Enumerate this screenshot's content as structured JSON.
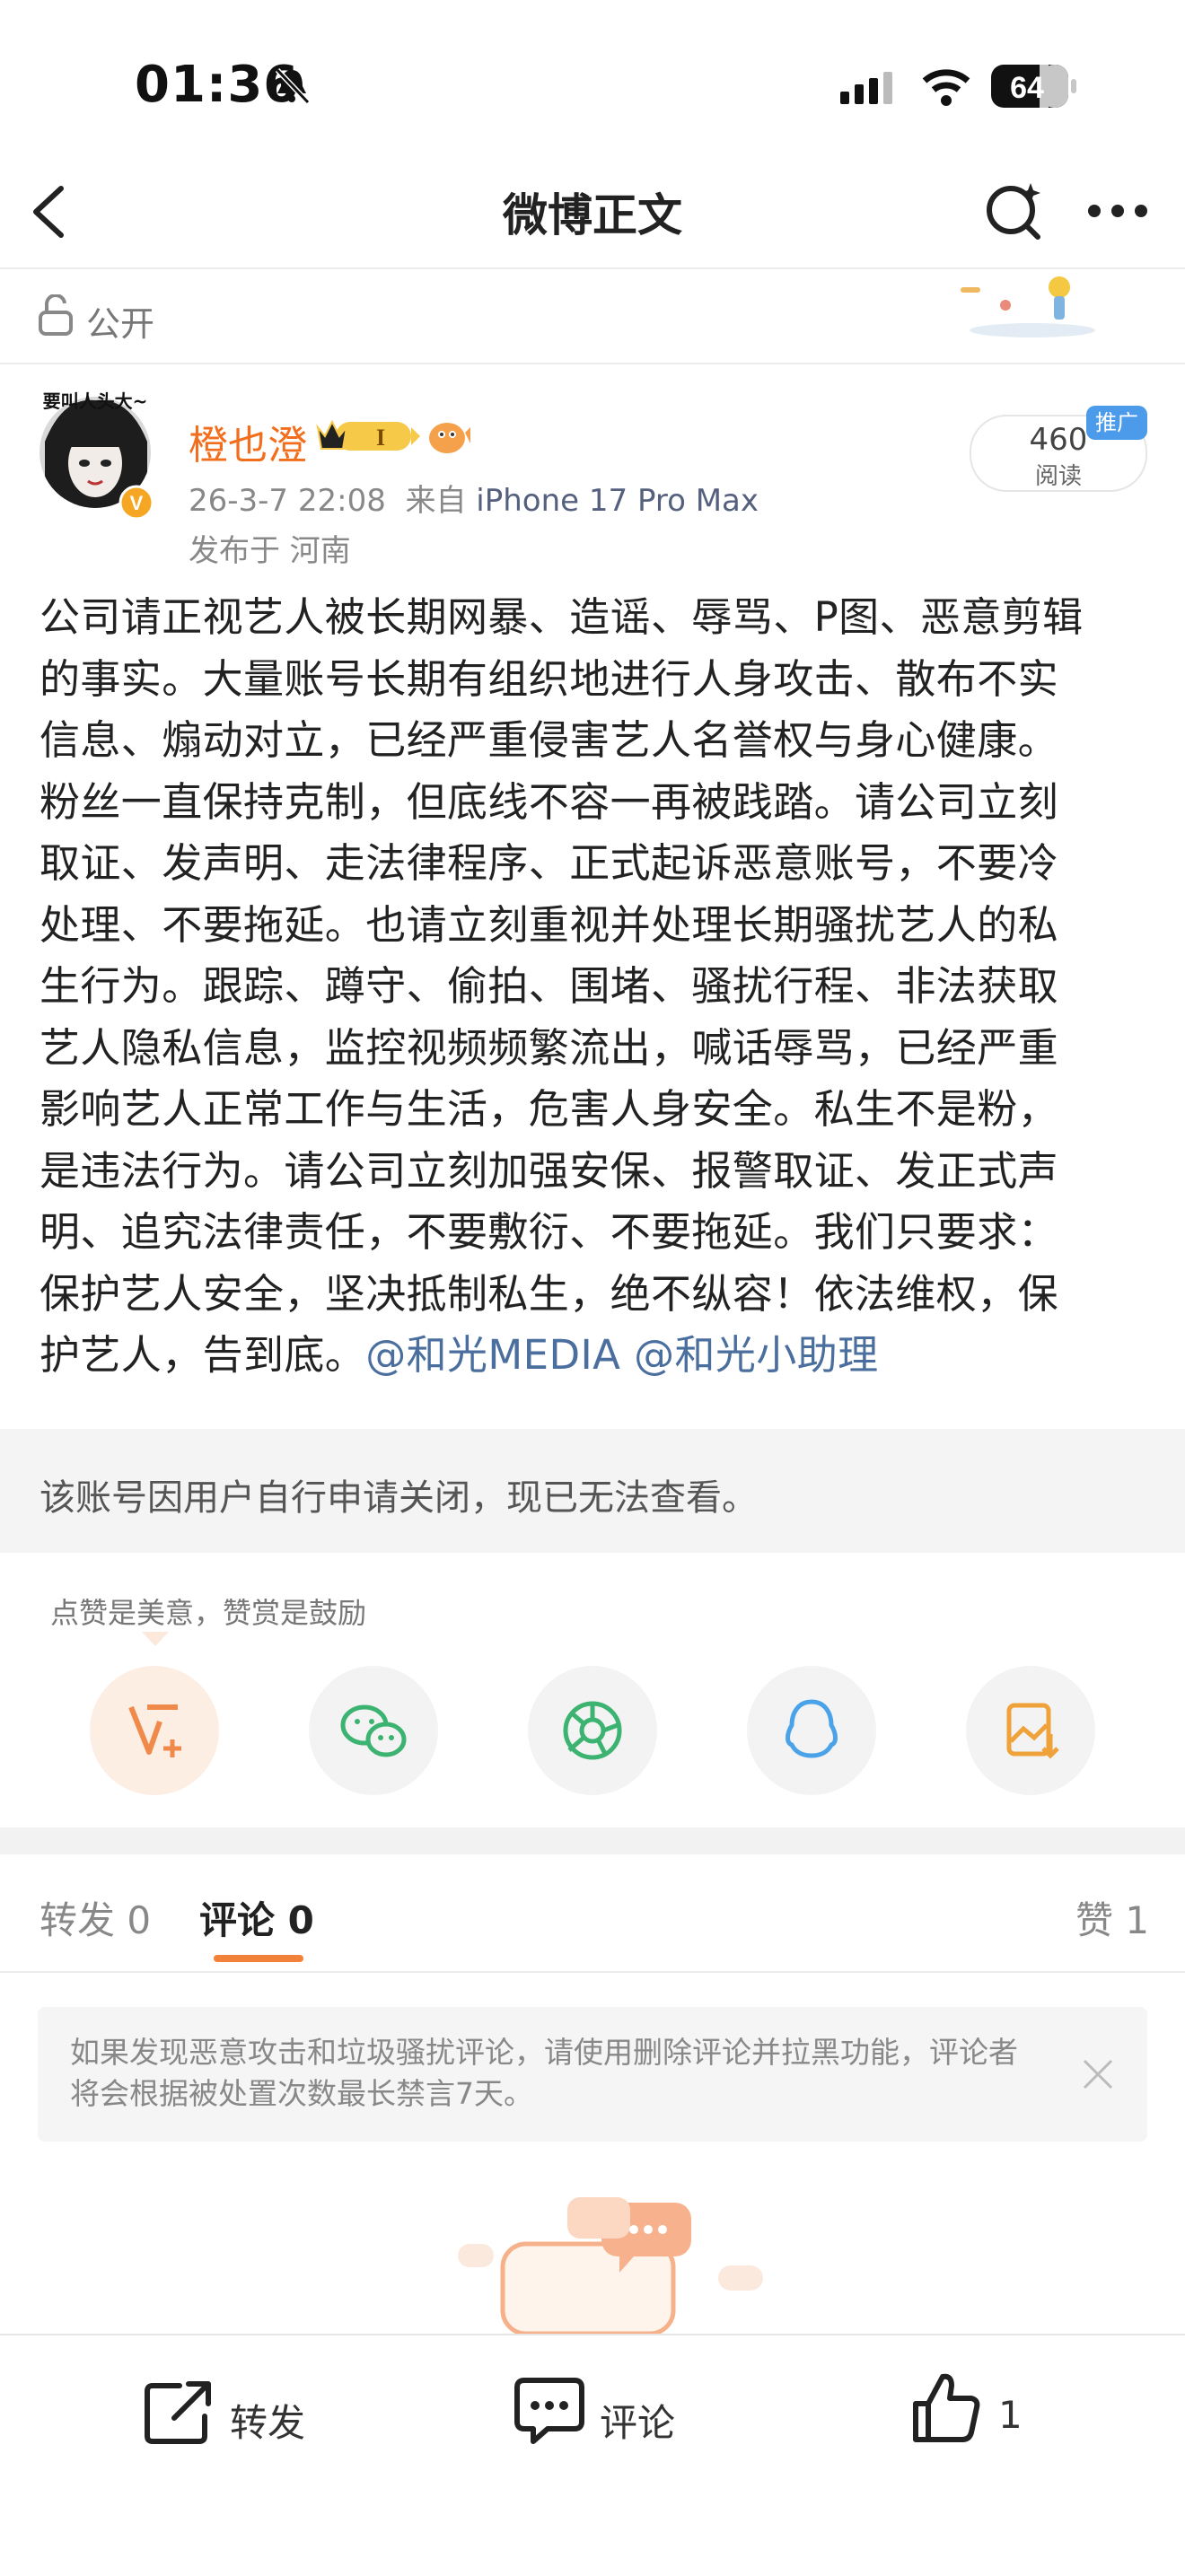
{
  "status_bar": {
    "time": "01:36",
    "battery": "64"
  },
  "nav": {
    "title": "微博正文"
  },
  "visibility": {
    "label": "公开"
  },
  "post": {
    "avatar_text": "要叫人头大~",
    "username": "橙也澄",
    "level_badge": "I",
    "timestamp": "26-3-7 22:08",
    "source_prefix": "来自",
    "device": "iPhone 17 Pro Max",
    "location": "发布于 河南",
    "read_count": "460",
    "read_label": "阅读",
    "promo_badge": "推广",
    "body_lines": [
      "公司请正视艺人被长期网暴、造谣、辱骂、P图、恶意剪辑",
      "的事实。大量账号长期有组织地进行人身攻击、散布不实",
      "信息、煽动对立，已经严重侵害艺人名誉权与身心健康。",
      "粉丝一直保持克制，但底线不容一再被践踏。请公司立刻",
      "取证、发声明、走法律程序、正式起诉恶意账号，不要冷",
      "处理、不要拖延。也请立刻重视并处理长期骚扰艺人的私",
      "生行为。跟踪、蹲守、偷拍、围堵、骚扰行程、非法获取",
      "艺人隐私信息，监控视频频繁流出，喊话辱骂，已经严重",
      "影响艺人正常工作与生活，危害人身安全。私生不是粉，",
      "是违法行为。请公司立刻加强安保、报警取证、发正式声",
      "明、追究法律责任，不要敷衍、不要拖延。我们只要求：",
      "保护艺人安全，坚决抵制私生，绝不纵容！依法维权，保"
    ],
    "body_last_prefix": "护艺人，告到底。",
    "mention_1": "@和光MEDIA",
    "mention_2": "@和光小助理"
  },
  "closed_notice": "该账号因用户自行申请关闭，现已无法查看。",
  "reward_tip": "点赞是美意，赞赏是鼓励",
  "share_icons": [
    "reward-v-icon",
    "wechat-icon",
    "moments-icon",
    "qq-icon",
    "save-image-icon"
  ],
  "tabs": {
    "repost": "转发 0",
    "comment": "评论 0",
    "like": "赞 1"
  },
  "comment_notice": "如果发现恶意攻击和垃圾骚扰评论，请使用删除评论并拉黑功能，评论者将会根据被处置次数最长禁言7天。",
  "bottom_bar": {
    "repost": "转发",
    "comment": "评论",
    "like_count": "1"
  },
  "colors": {
    "accent": "#f26d1c",
    "mention": "#4a6e9e",
    "promo": "#4c9bea",
    "tab_underline": "#f2823a"
  }
}
